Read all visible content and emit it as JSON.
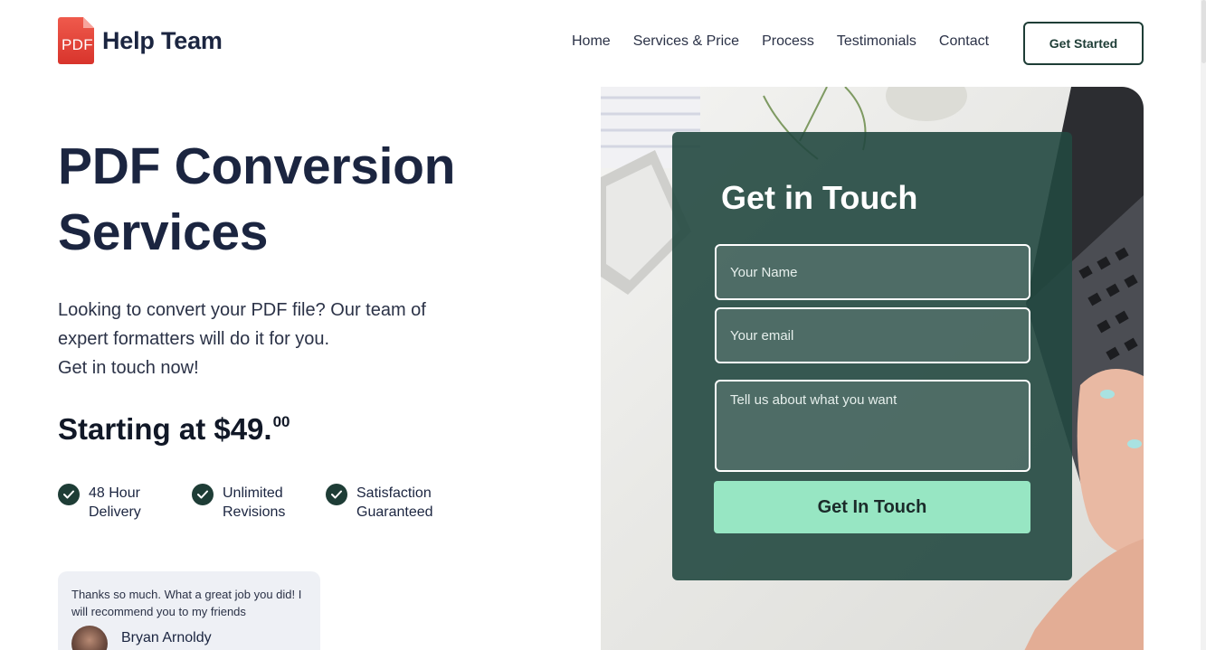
{
  "header": {
    "logo_badge": "PDF",
    "logo_text": "Help Team",
    "nav": [
      {
        "label": "Home"
      },
      {
        "label": "Services & Price"
      },
      {
        "label": "Process"
      },
      {
        "label": "Testimonials"
      },
      {
        "label": "Contact"
      }
    ],
    "cta_label": "Get Started"
  },
  "hero": {
    "title_line1": "PDF Conversion",
    "title_line2": "Services",
    "description": [
      "Looking to convert your PDF file? Our team of",
      "expert formatters will do it for you.",
      "Get in touch now!"
    ],
    "price_prefix": "Starting at $49.",
    "price_cents": "00",
    "features": [
      {
        "line1": "48 Hour",
        "line2": "Delivery",
        "icon": "check-icon"
      },
      {
        "line1": "Unlimited",
        "line2": "Revisions",
        "icon": "check-icon"
      },
      {
        "line1": "Satisfaction",
        "line2": "Guaranteed",
        "icon": "check-icon"
      }
    ],
    "testimonial": {
      "quote": "Thanks so much. What a great job you did! I will recommend you to my friends",
      "name": "Bryan Arnoldy"
    }
  },
  "contact_form": {
    "title": "Get in Touch",
    "name_placeholder": "Your Name",
    "email_placeholder": "Your email",
    "message_placeholder": "Tell us about what you want",
    "submit_label": "Get In Touch"
  },
  "colors": {
    "brand_dark": "#1e3d36",
    "accent_green": "#97e6c3",
    "logo_red": "#e8453c",
    "heading": "#1b2540"
  }
}
